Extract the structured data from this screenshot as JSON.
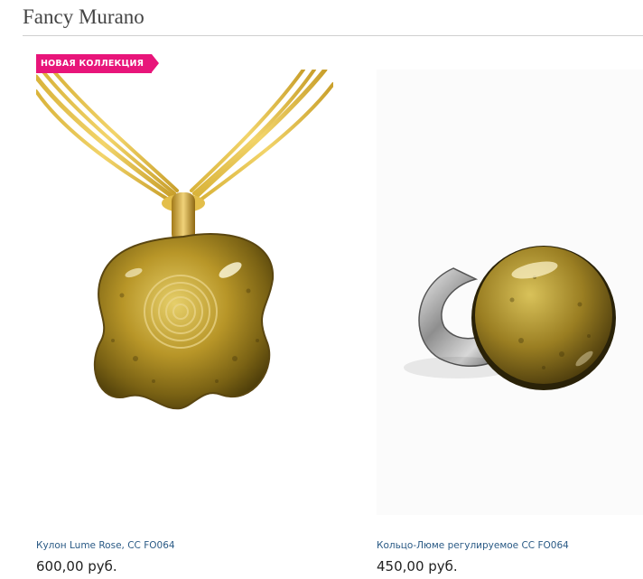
{
  "header": {
    "title": "Fancy Murano"
  },
  "products": [
    {
      "badge": "НОВАЯ КОЛЛЕКЦИЯ",
      "name": "Кулон Lume Rose, CC FO064",
      "price": "600,00 руб.",
      "image": "pendant-image"
    },
    {
      "name": "Кольцо-Люме регулируемое CC FO064",
      "price": "450,00 руб.",
      "image": "ring-image"
    }
  ],
  "colors": {
    "badge": "#e8157a",
    "link": "#2a5a85",
    "gold": "#b8962a"
  }
}
